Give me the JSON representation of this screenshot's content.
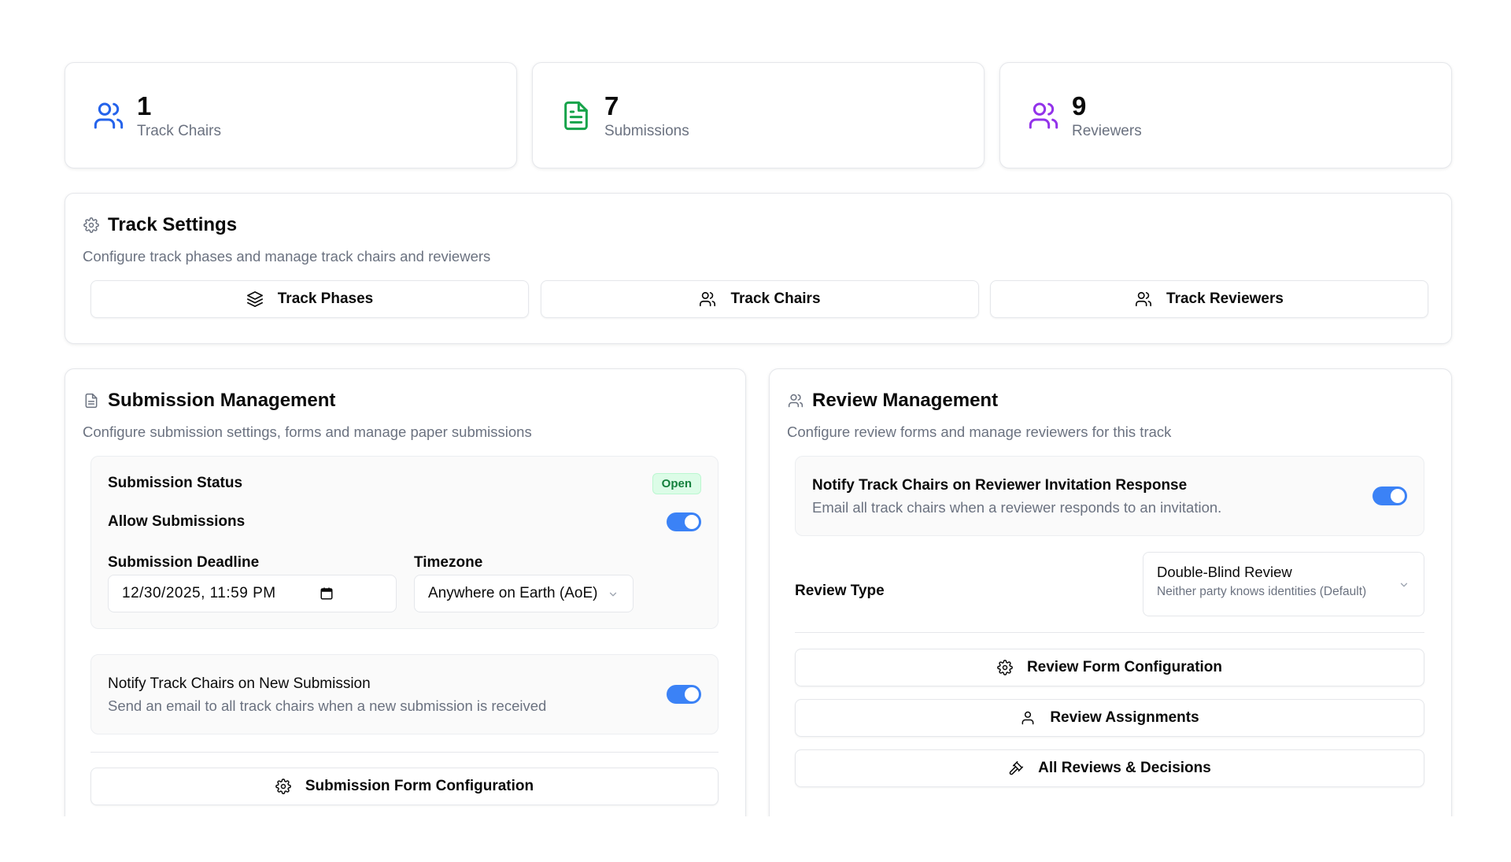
{
  "stats": [
    {
      "value": "1",
      "label": "Track Chairs",
      "icon": "users-icon",
      "color": "#2563eb"
    },
    {
      "value": "7",
      "label": "Submissions",
      "icon": "file-text-icon",
      "color": "#16a34a"
    },
    {
      "value": "9",
      "label": "Reviewers",
      "icon": "users-icon",
      "color": "#9333ea"
    }
  ],
  "track_settings": {
    "title": "Track Settings",
    "subtitle": "Configure track phases and manage track chairs and reviewers",
    "buttons": {
      "phases": "Track Phases",
      "chairs": "Track Chairs",
      "reviewers": "Track Reviewers"
    }
  },
  "submission": {
    "title": "Submission Management",
    "subtitle": "Configure submission settings, forms and manage paper submissions",
    "status_label": "Submission Status",
    "status_badge": "Open",
    "allow_label": "Allow Submissions",
    "deadline_label": "Submission Deadline",
    "deadline_value": "12/30/2025, 11:59 PM",
    "timezone_label": "Timezone",
    "timezone_value": "Anywhere on Earth (AoE)",
    "notify_title": "Notify Track Chairs on New Submission",
    "notify_desc": "Send an email to all track chairs when a new submission is received",
    "form_button": "Submission Form Configuration"
  },
  "review": {
    "title": "Review Management",
    "subtitle": "Configure review forms and manage reviewers for this track",
    "notify_title": "Notify Track Chairs on Reviewer Invitation Response",
    "notify_desc": "Email all track chairs when a reviewer responds to an invitation.",
    "type_label": "Review Type",
    "type_value": "Double-Blind Review",
    "type_desc": "Neither party knows identities (Default)",
    "buttons": {
      "form": "Review Form Configuration",
      "assignments": "Review Assignments",
      "decisions": "All Reviews & Decisions"
    }
  },
  "colors": {
    "accent": "#3b82f6",
    "badge_green": "#15803d"
  }
}
